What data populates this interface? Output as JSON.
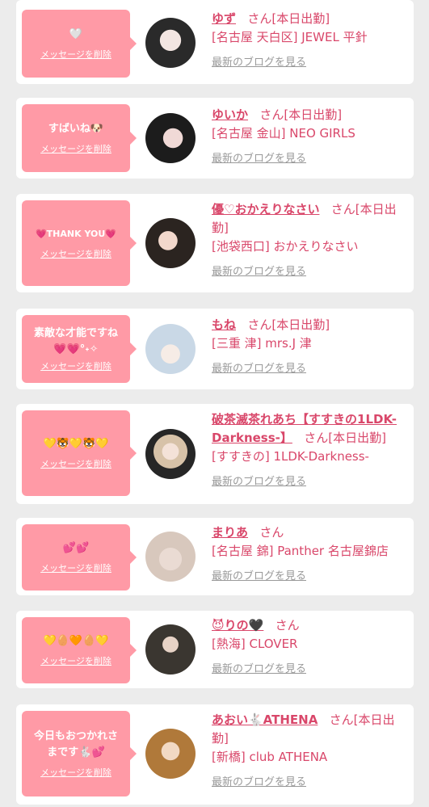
{
  "common": {
    "delete_label": "メッセージを削除",
    "blog_label": "最新のブログを見る",
    "san": "さん"
  },
  "entries": [
    {
      "message": "🤍",
      "name": "ゆず",
      "status": "[本日出勤]",
      "shop": "[名古屋 天白区] JEWEL 平針"
    },
    {
      "message": "すばいね🐶",
      "name": "ゆいか",
      "status": "[本日出勤]",
      "shop": "[名古屋 金山] NEO GIRLS"
    },
    {
      "message": "💗THANK YOU💗",
      "name": "優♡おかえりなさい",
      "status": "[本日出勤]",
      "shop": "[池袋西口] おかえりなさい"
    },
    {
      "message": "素敵な才能ですね\n💗💗°˖✧",
      "name": "もね",
      "status": "[本日出勤]",
      "shop": "[三重 津] mrs.J 津"
    },
    {
      "message": "💛🐯💛🐯💛",
      "name": "破茶滅茶れあち【すすきの1LDK-Darkness-】",
      "status": "[本日出勤]",
      "shop": "[すすきの] 1LDK-Darkness-"
    },
    {
      "message": "💕💕",
      "name": "まりあ",
      "status": "",
      "shop": "[名古屋 錦] Panther 名古屋錦店"
    },
    {
      "message": "💛🥚🧡🥚💛",
      "name": "😈りの🖤",
      "status": "",
      "shop": "[熱海] CLOVER"
    },
    {
      "message": "今日もおつかれさ\nまです🐇💕",
      "name": "あおい🐇ATHENA",
      "status": "[本日出勤]",
      "shop": "[新橋] club ATHENA"
    }
  ],
  "colors": {
    "accent": "#d9476a",
    "bubble": "#ff9aa6",
    "background": "#ececec",
    "muted": "#999999"
  }
}
